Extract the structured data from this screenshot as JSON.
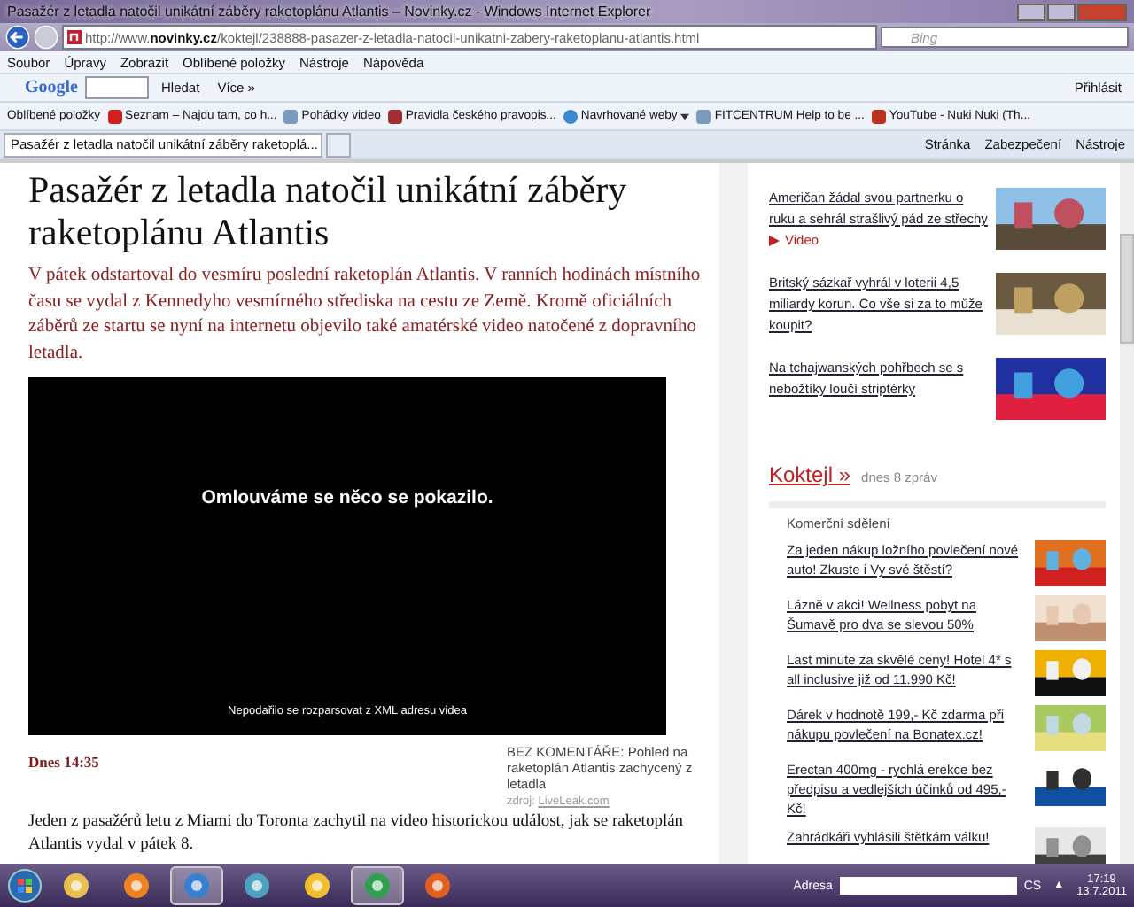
{
  "window": {
    "title": "Pasažér z letadla natočil unikátní záběry raketoplánu Atlantis – Novinky.cz - Windows Internet Explorer"
  },
  "address_bar": {
    "url": "http://www.**novinky.cz**/koktejl/238888-pasazer-z-letadla-natocil-unikatni-zabery-raketoplanu-atlantis.html",
    "search_placeholder": "Bing"
  },
  "menu": [
    "Soubor",
    "Úpravy",
    "Zobrazit",
    "Oblíbené položky",
    "Nástroje",
    "Nápověda"
  ],
  "google_toolbar": {
    "logo": "Google",
    "search_button": "Hledat",
    "more": "Více »",
    "sign_in": "Přihlásit"
  },
  "favorites_bar": {
    "label": "Oblíbené položky",
    "items": [
      {
        "label": "Seznam – Najdu tam, co h...",
        "kind": "seznam",
        "dropdown": false
      },
      {
        "label": "Pohádky video",
        "kind": "page",
        "dropdown": false
      },
      {
        "label": "Pravidla českého pravopis...",
        "kind": "doc",
        "dropdown": false
      },
      {
        "label": "Navrhované weby",
        "kind": "ie",
        "dropdown": true
      },
      {
        "label": "FITCENTRUM  Help to be ...",
        "kind": "page",
        "dropdown": false
      },
      {
        "label": "YouTube - Nuki Nuki (Th...",
        "kind": "youtube",
        "dropdown": false
      }
    ]
  },
  "tabs": [
    {
      "label": "Pasažér z letadla natočil unikátní záběry raketoplá...",
      "selected": true
    }
  ],
  "command_bar": [
    "Stránka",
    "Zabezpečení",
    "Nástroje"
  ],
  "article": {
    "headline": "Pasažér z letadla natočil unikátní záběry raketoplánu Atlantis",
    "perex": "V pátek odstartoval do vesmíru poslední raketoplán Atlantis. V ranních hodinách místního času se vydal z Kennedyho vesmírného střediska na cestu ze Země. Kromě oficiálních záběrů ze startu se nyní na internetu objevilo také amatérské video natočené z dopravního letadla.",
    "video_error": "Omlouváme se něco se pokazilo.",
    "video_detail": "Nepodařilo se rozparsovat z XML adresu videa",
    "date": "Dnes 14:35",
    "caption": "BEZ KOMENTÁŘE: Pohled na raketoplán Atlantis zachycený z letadla",
    "source_label": "zdroj:",
    "source_link": "LiveLeak.com",
    "body": "Jeden z pasažérů letu z Miami do Toronta zachytil na video historickou událost, jak se raketoplán Atlantis vydal v pátek 8."
  },
  "related": [
    {
      "title": "Američan žádal svou partnerku o ruku a sehrál strašlivý pád ze střechy",
      "video": "Video"
    },
    {
      "title": "Britský sázkař vyhrál v loterii 4,5 miliardy korun. Co vše si za to může koupit?"
    },
    {
      "title": "Na tchajwanských pohřbech se s nebožtíky loučí striptérky"
    }
  ],
  "section": {
    "name": "Koktejl »",
    "count": "dnes 8 zpráv"
  },
  "commercial": {
    "heading": "Komerční sdělení",
    "items": [
      "Za jeden nákup ložního povlečení nové auto! Zkuste i Vy své štěstí?",
      "Lázně v akci! Wellness pobyt na Šumavě pro dva se slevou 50%",
      "Last minute za skvělé ceny! Hotel 4* s all inclusive již od 11.990 Kč!",
      "Dárek v hodnotě 199,- Kč zdarma při nákupu povlečení na Bonatex.cz!",
      "Erectan 400mg - rychlá erekce bez předpisu a vedlejších účinků od 495,- Kč!",
      "Zahrádkáři vyhlásili štětkám válku!"
    ]
  },
  "taskbar": {
    "apps": [
      {
        "kind": "folder",
        "selected": false
      },
      {
        "kind": "media",
        "selected": false
      },
      {
        "kind": "browser",
        "selected": true
      },
      {
        "kind": "chat",
        "selected": false
      },
      {
        "kind": "game",
        "selected": false
      },
      {
        "kind": "green",
        "selected": true
      },
      {
        "kind": "firefox",
        "selected": false
      }
    ],
    "address_label": "Adresa",
    "language": "CS",
    "tray_arrow": "▲",
    "time": "17:19",
    "date": "13.7.2011"
  }
}
